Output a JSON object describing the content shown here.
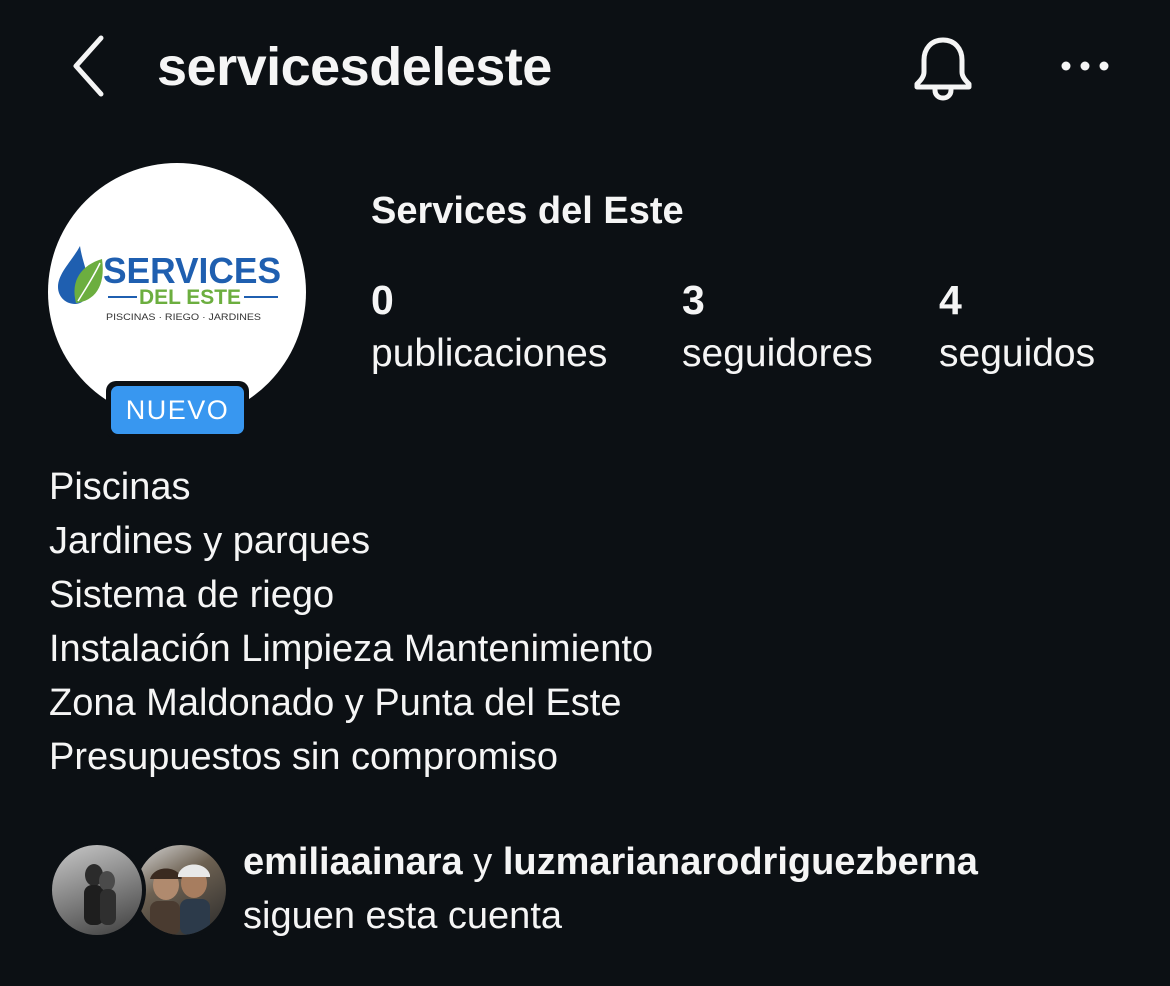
{
  "header": {
    "username": "servicesdeleste",
    "back_icon": "chevron-left-icon",
    "bell_icon": "bell-icon",
    "more_icon": "more-horizontal-icon"
  },
  "profile": {
    "display_name": "Services del Este",
    "badge": "NUEVO",
    "badge_color": "#3897f0",
    "logo": {
      "line1": "SERVICES",
      "line2": "DEL ESTE",
      "line3": "PISCINAS · RIEGO · JARDINES",
      "brand_blue": "#1f5fb0",
      "brand_green": "#6cae3f"
    }
  },
  "stats": [
    {
      "value": "0",
      "label": "publicaciones"
    },
    {
      "value": "3",
      "label": "seguidores"
    },
    {
      "value": "4",
      "label": "seguidos"
    }
  ],
  "bio": [
    "Piscinas",
    "Jardines y parques",
    "Sistema de riego",
    "Instalación Limpieza Mantenimiento",
    "Zona Maldonado y Punta del Este",
    "Presupuestos sin compromiso"
  ],
  "followed_by": {
    "user1": "emiliaainara",
    "connector": " y ",
    "user2": "luzmarianarodriguezberna",
    "suffix": "siguen esta cuenta"
  },
  "colors": {
    "background": "#0c1014",
    "text": "#f5f5f5"
  }
}
